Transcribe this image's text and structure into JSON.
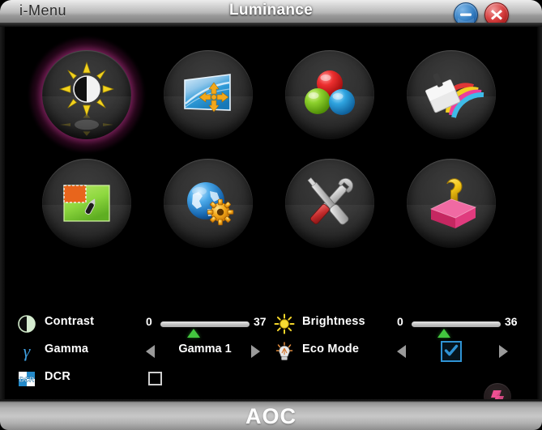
{
  "window": {
    "app_name": "i-Menu",
    "page_title": "Luminance",
    "minimize_label": "Minimize",
    "close_label": "Close",
    "brand": "AOC"
  },
  "menu_icons": [
    {
      "id": "luminance",
      "name": "luminance-icon",
      "selected": true
    },
    {
      "id": "image-setup",
      "name": "image-setup-icon",
      "selected": false
    },
    {
      "id": "color-setup",
      "name": "color-setup-icon",
      "selected": false
    },
    {
      "id": "picture-boost",
      "name": "picture-boost-icon",
      "selected": false
    },
    {
      "id": "osd-setup",
      "name": "osd-setup-icon",
      "selected": false
    },
    {
      "id": "extra",
      "name": "extra-globe-icon",
      "selected": false
    },
    {
      "id": "tools",
      "name": "tools-icon",
      "selected": false
    },
    {
      "id": "exit",
      "name": "exit-help-icon",
      "selected": false
    }
  ],
  "controls": {
    "contrast": {
      "label": "Contrast",
      "icon": "contrast-icon",
      "min": "0",
      "max": "37",
      "value": 37,
      "percent": 37
    },
    "brightness": {
      "label": "Brightness",
      "icon": "brightness-sun-icon",
      "min": "0",
      "max": "36",
      "value": 36,
      "percent": 36
    },
    "gamma": {
      "label": "Gamma",
      "icon": "gamma-icon",
      "value": "Gamma 1",
      "prev_label": "Previous",
      "next_label": "Next"
    },
    "eco_mode": {
      "label": "Eco Mode",
      "icon": "eco-mode-bulb-icon",
      "checked": true,
      "prev_label": "Previous",
      "next_label": "Next"
    },
    "dcr": {
      "label": "DCR",
      "icon": "dcr-icon",
      "checked": false
    },
    "reset": {
      "label": "Reset",
      "icon": "reset-icon"
    }
  },
  "colors": {
    "accent_selected": "#ef50be",
    "slider_knob": "#43c63f",
    "checkbox_checked": "#2f93d4",
    "gamma_symbol": "#3f9fe0",
    "panel_bg": "#000000"
  }
}
